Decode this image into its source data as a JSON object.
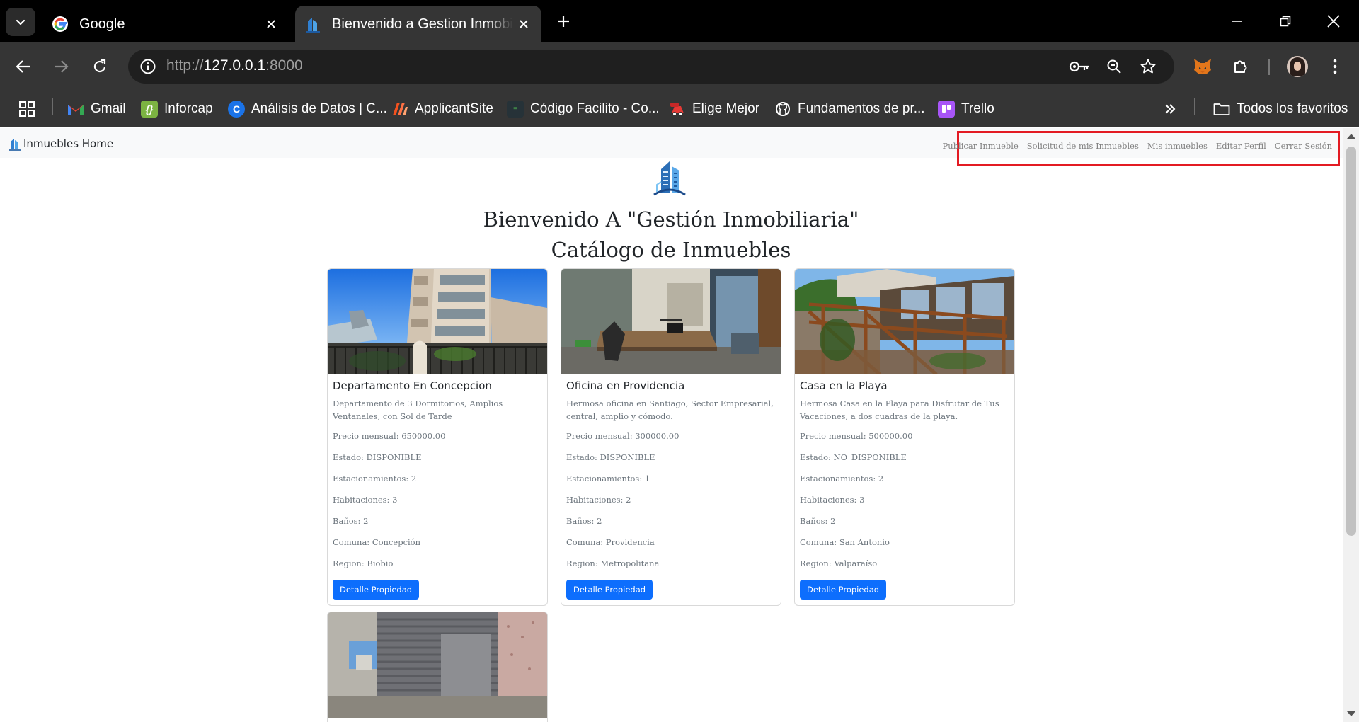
{
  "browser": {
    "tabs": [
      {
        "title": "Google",
        "favicon": "google-icon"
      },
      {
        "title": "Bienvenido a Gestion Inmobiliaria",
        "favicon": "building-logo-icon"
      }
    ],
    "url_scheme": "http://",
    "url_host": "127.0.0.1",
    "url_port": ":8000",
    "bookmarks": [
      {
        "label": "Gmail",
        "icon": "gmail-icon",
        "color": "#ea4335"
      },
      {
        "label": "Inforcap",
        "icon": "inforcap-icon",
        "color": "#7cb342"
      },
      {
        "label": "Análisis de Datos | C...",
        "icon": "coursera-icon",
        "color": "#1a73e8"
      },
      {
        "label": "ApplicantSite",
        "icon": "applicantsite-icon",
        "color": "#f4511e"
      },
      {
        "label": "Código Facilito - Co...",
        "icon": "codigofacilito-icon",
        "color": "#2e7d32"
      },
      {
        "label": "Elige Mejor",
        "icon": "eligemejor-icon",
        "color": "#e53935"
      },
      {
        "label": "Fundamentos de pr...",
        "icon": "github-icon",
        "color": "#ffffff"
      },
      {
        "label": "Trello",
        "icon": "trello-icon",
        "color": "#a855f7"
      }
    ],
    "all_bookmarks_label": "Todos los favoritos"
  },
  "site": {
    "brand": "Inmuebles Home",
    "nav_links": [
      "Publicar Inmueble",
      "Solicitud de mis Inmuebles",
      "Mis inmuebles",
      "Editar Perfil",
      "Cerrar Sesión"
    ],
    "heading_line1": "Bienvenido A \"Gestión Inmobiliaria\"",
    "heading_line2": "Catálogo de Inmuebles",
    "button_label": "Detalle Propiedad",
    "cards": [
      {
        "title": "Departamento En Concepcion",
        "description": "Departamento de 3 Dormitorios, Amplios Ventanales, con Sol de Tarde",
        "precio": "Precio mensual: 650000.00",
        "estado": "Estado: DISPONIBLE",
        "estacionamientos": "Estacionamientos: 2",
        "habitaciones": "Habitaciones: 3",
        "banos": "Baños: 2",
        "comuna": "Comuna: Concepción",
        "region": "Region: Biobio"
      },
      {
        "title": "Oficina en Providencia",
        "description": "Hermosa oficina en Santiago, Sector Empresarial, central, amplio y cómodo.",
        "precio": "Precio mensual: 300000.00",
        "estado": "Estado: DISPONIBLE",
        "estacionamientos": "Estacionamientos: 1",
        "habitaciones": "Habitaciones: 2",
        "banos": "Baños: 2",
        "comuna": "Comuna: Providencia",
        "region": "Region: Metropolitana"
      },
      {
        "title": "Casa en la Playa",
        "description": "Hermosa Casa en la Playa para Disfrutar de Tus Vacaciones, a dos cuadras de la playa.",
        "precio": "Precio mensual: 500000.00",
        "estado": "Estado: NO_DISPONIBLE",
        "estacionamientos": "Estacionamientos: 2",
        "habitaciones": "Habitaciones: 3",
        "banos": "Baños: 2",
        "comuna": "Comuna: San Antonio",
        "region": "Region: Valparaíso"
      }
    ]
  },
  "colors": {
    "primary_button": "#0d6efd",
    "highlight_box": "#e31b23",
    "browser_frame": "#353535"
  }
}
